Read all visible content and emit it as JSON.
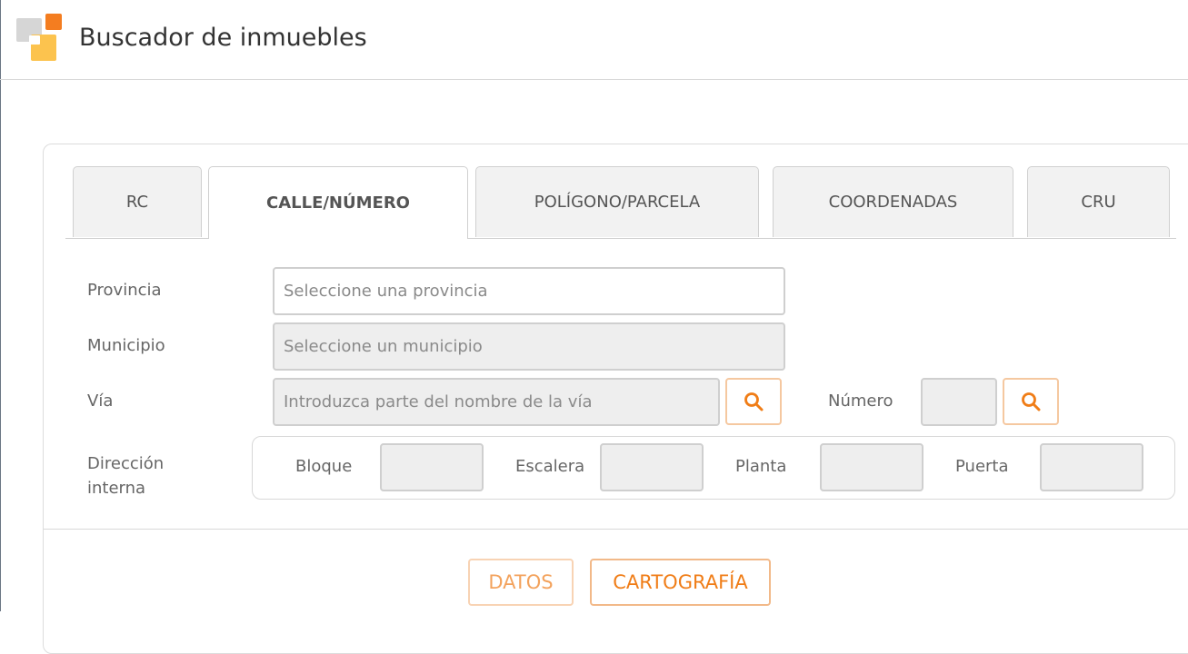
{
  "header": {
    "title": "Buscador de inmuebles"
  },
  "tabs": [
    {
      "label": "RC"
    },
    {
      "label": "CALLE/NÚMERO"
    },
    {
      "label": "POLÍGONO/PARCELA"
    },
    {
      "label": "COORDENADAS"
    },
    {
      "label": "CRU"
    }
  ],
  "active_tab": "CALLE/NÚMERO",
  "form": {
    "provincia": {
      "label": "Provincia",
      "placeholder": "Seleccione una provincia"
    },
    "municipio": {
      "label": "Municipio",
      "placeholder": "Seleccione un municipio"
    },
    "via": {
      "label": "Vía",
      "placeholder": "Introduzca parte del nombre de la vía"
    },
    "numero": {
      "label": "Número"
    },
    "direccion_interna": {
      "label_line1": "Dirección",
      "label_line2": "interna",
      "bloque": "Bloque",
      "escalera": "Escalera",
      "planta": "Planta",
      "puerta": "Puerta"
    }
  },
  "actions": {
    "datos": "DATOS",
    "cartografia": "CARTOGRAFÍA"
  },
  "colors": {
    "accent": "#f07d17",
    "accent_light": "#f5c8a0",
    "logo_orange": "#f47d20",
    "logo_yellow": "#fcc34e",
    "logo_gray": "#d6d6d6"
  },
  "icons": {
    "logo": "app-logo-icon",
    "search": "search-icon"
  }
}
